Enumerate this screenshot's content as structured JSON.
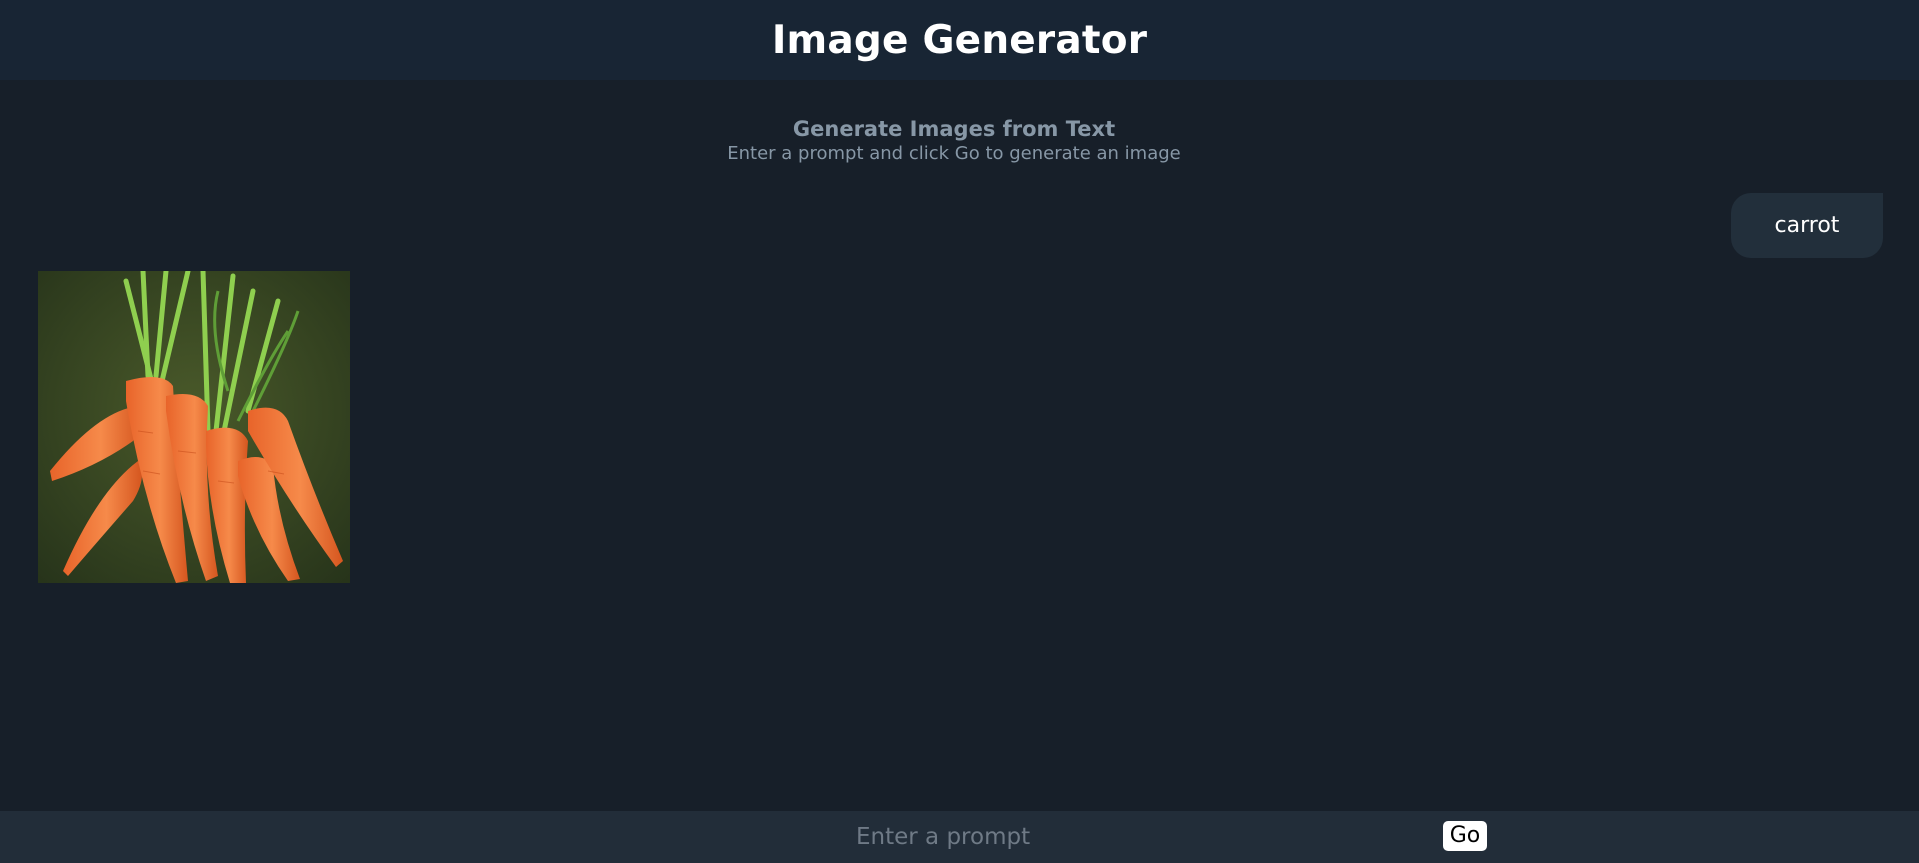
{
  "header": {
    "title": "Image Generator"
  },
  "intro": {
    "heading": "Generate Images from Text",
    "subheading": "Enter a prompt and click Go to generate an image"
  },
  "conversation": {
    "user_prompt": "carrot",
    "result_image_icon": "generated-image-carrots"
  },
  "composer": {
    "placeholder": "Enter a prompt",
    "value": "",
    "go_label": "Go"
  },
  "colors": {
    "background": "#171f29",
    "header_bg": "#182534",
    "bubble_bg": "#222f3b",
    "input_bar_bg": "#222d39",
    "muted_text": "#8797a6",
    "button_bg": "#ffffff"
  }
}
